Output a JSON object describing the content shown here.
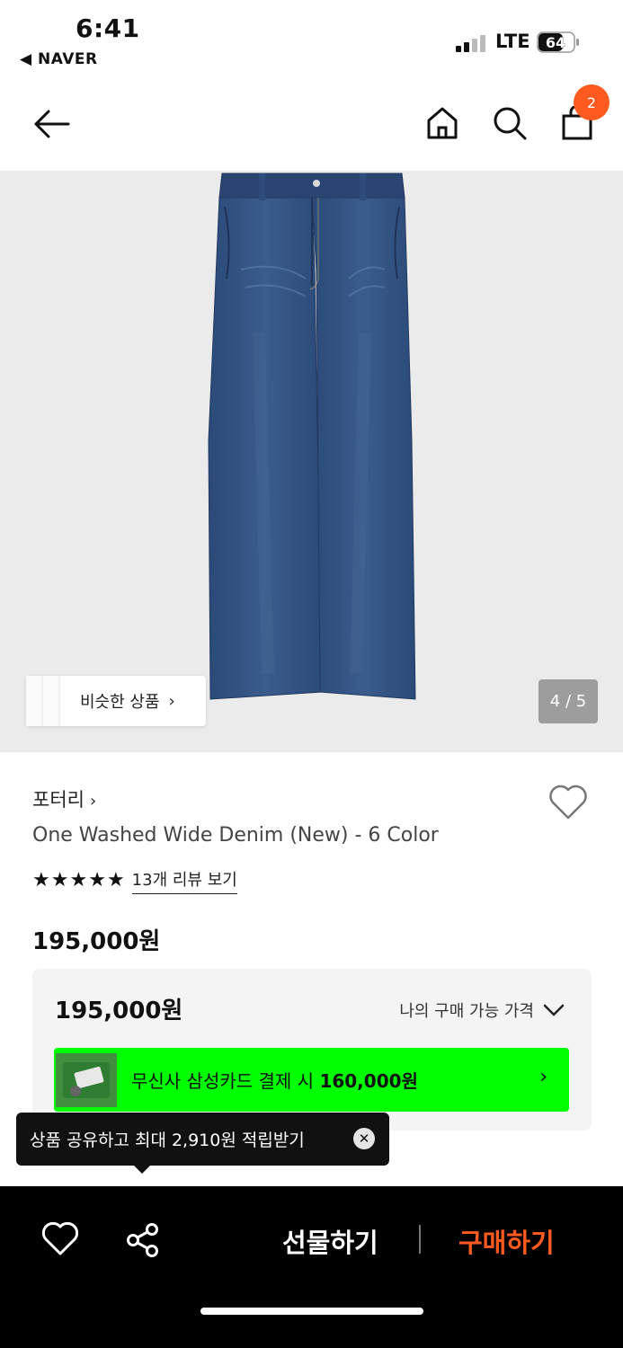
{
  "status": {
    "time": "6:41",
    "back_app": "◀ NAVER",
    "network": "LTE",
    "battery": "64"
  },
  "nav": {
    "cart_count": "2"
  },
  "gallery": {
    "similar_label": "비슷한 상품",
    "page_counter": "4 / 5"
  },
  "product": {
    "brand": "포터리",
    "title": "One Washed Wide Denim (New) - 6 Color",
    "stars": 5,
    "review_link": "13개 리뷰 보기",
    "price": "195,000원"
  },
  "price_box": {
    "my_price": "195,000원",
    "available_label": "나의 구매 가능 가격",
    "promo_prefix": "무신사 삼성카드 결제 시 ",
    "promo_price": "160,000원"
  },
  "tooltip": {
    "message": "상품 공유하고 최대 2,910원 적립받기"
  },
  "bottom_bar": {
    "gift_label": "선물하기",
    "buy_label": "구매하기"
  },
  "colors": {
    "accent": "#ff5a1f",
    "promo_green": "#00ff00",
    "denim": "#2f4f7c"
  }
}
